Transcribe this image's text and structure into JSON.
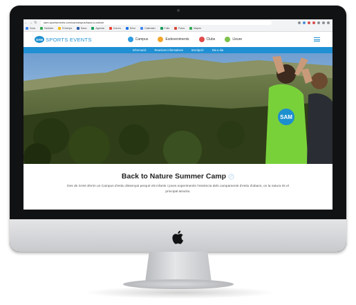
{
  "browser": {
    "url": "sam.sportsevents.com/ca/campus/back-to-nature",
    "nav_glyphs": {
      "back": "←",
      "forward": "→",
      "reload": "↻"
    },
    "bookmarks": [
      {
        "label": "Docs",
        "color": "#4285f4"
      },
      {
        "label": "Notícies",
        "color": "#34a853"
      },
      {
        "label": "El temps",
        "color": "#fbbc05"
      },
      {
        "label": "Banc",
        "color": "#2a5aa8"
      },
      {
        "label": "Agenda",
        "color": "#0f9d58"
      },
      {
        "label": "Correu",
        "color": "#ea4335"
      },
      {
        "label": "Drive",
        "color": "#1a73e8"
      },
      {
        "label": "Calendari",
        "color": "#4285f4"
      },
      {
        "label": "Fulls",
        "color": "#0f9d58"
      },
      {
        "label": "Fotos",
        "color": "#db4437"
      },
      {
        "label": "Mapes",
        "color": "#34a853"
      }
    ]
  },
  "site": {
    "logo_badge": "SAM",
    "logo_text": "SPORTS EVENTS",
    "brand_color": "#1d8fcf",
    "main_nav": [
      {
        "label": "Campus",
        "icon": "tent-icon",
        "color": "#2f9be0"
      },
      {
        "label": "Esdeveniments",
        "icon": "calendar-icon",
        "color": "#f3a62b"
      },
      {
        "label": "Clubs",
        "icon": "shield-icon",
        "color": "#e14b4b"
      },
      {
        "label": "Lleure",
        "icon": "star-icon",
        "color": "#7cc24d"
      }
    ],
    "subnav": [
      "Informació",
      "Reunions informatives",
      "Inscripció",
      "Dia a dia"
    ]
  },
  "hero": {
    "shirt_badge": "SAM"
  },
  "intro": {
    "title": "Back to Nature Summer Camp",
    "text": "Des de SAM oferim un Campus d'estiu dissenyat perquè els infants i joves experimentin l'essència dels campaments d'estiu d'abans, on la natura és el principal atractiu."
  }
}
